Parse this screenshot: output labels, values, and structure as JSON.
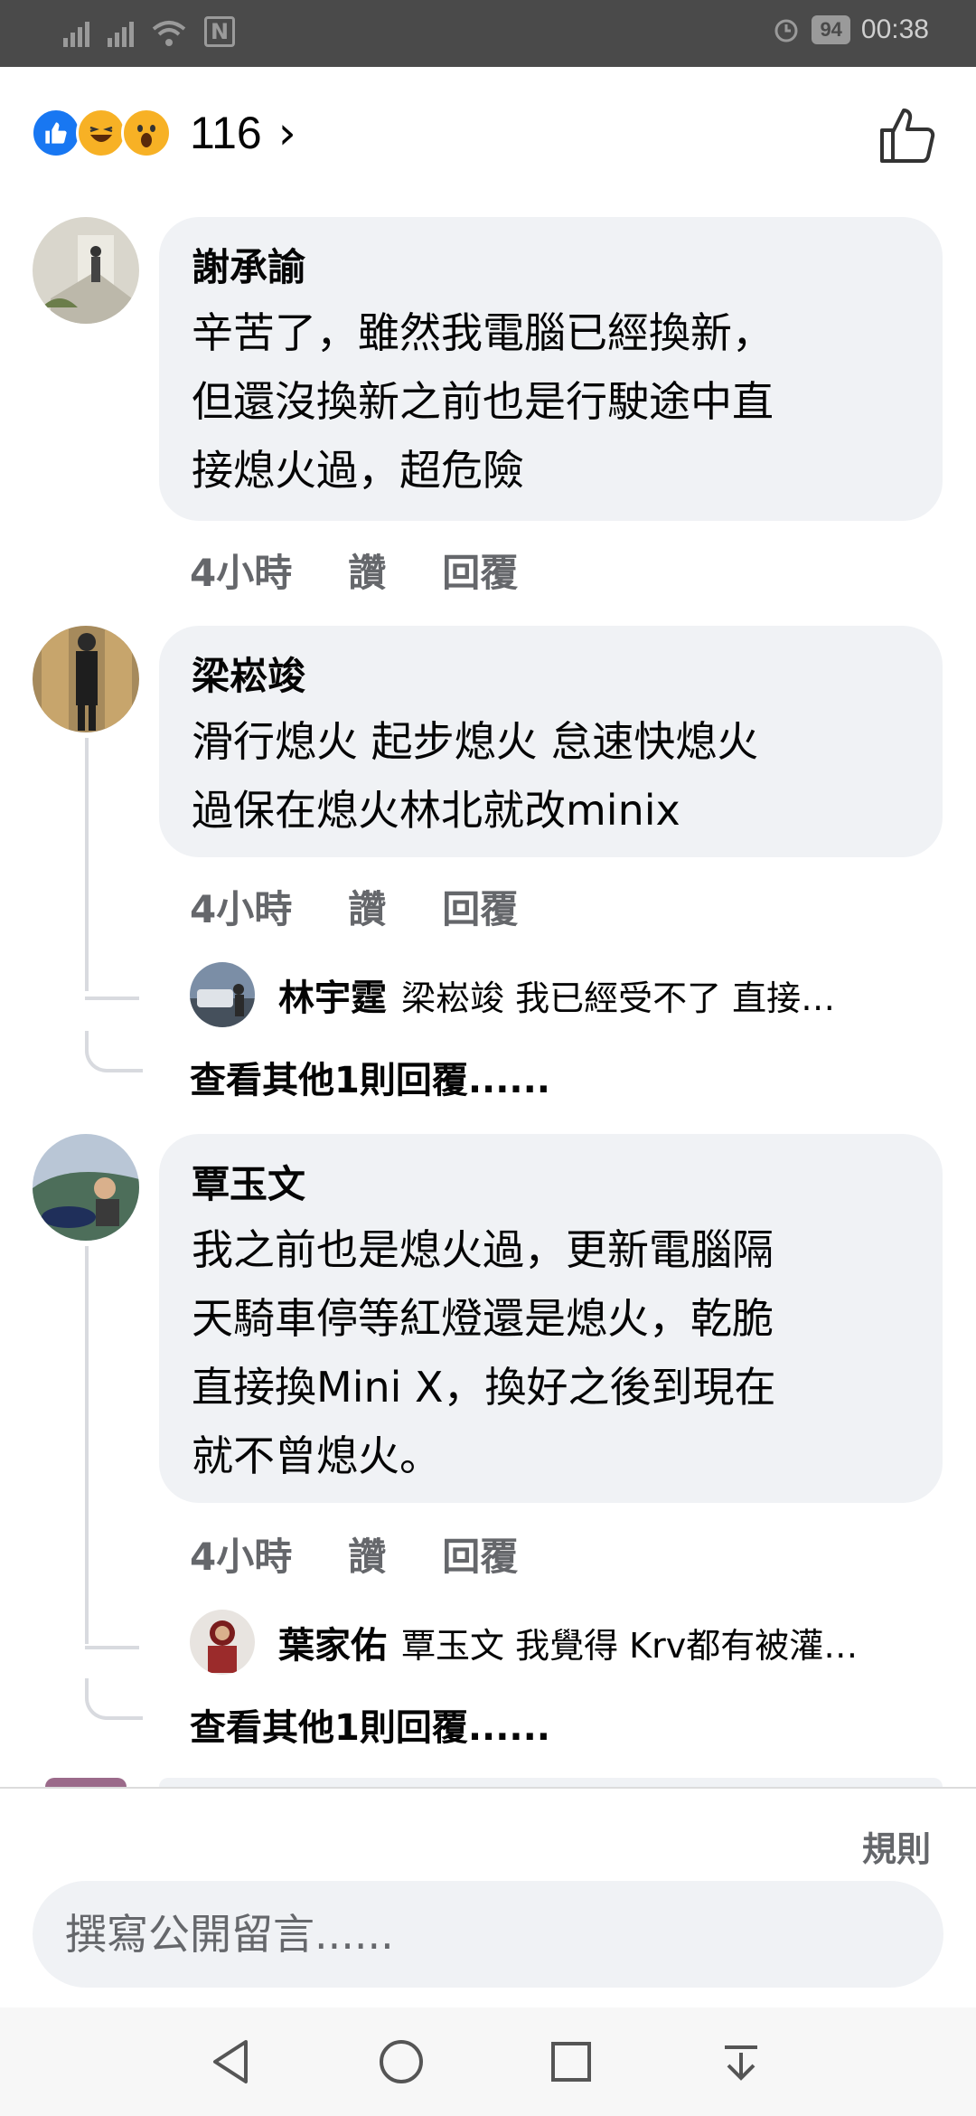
{
  "status_bar": {
    "time": "00:38",
    "battery": "94",
    "nfc_label": "N"
  },
  "reactions": {
    "count": "116",
    "chevron": "›"
  },
  "comments": [
    {
      "author": "謝承諭",
      "text_lines": [
        "辛苦了，雖然我電腦已經換新，",
        "但還沒換新之前也是行駛途中直",
        "接熄火過，超危險"
      ],
      "time": "4小時",
      "like": "讚",
      "reply": "回覆"
    },
    {
      "author": "梁崧竣",
      "text_lines": [
        "滑行熄火 起步熄火 怠速快熄火",
        "過保在熄火林北就改minix"
      ],
      "time": "4小時",
      "like": "讚",
      "reply": "回覆",
      "reply_preview": {
        "name": "林宇霆",
        "text": "梁崧竣 我已經受不了 直接…"
      },
      "more_replies": "查看其他1則回覆......"
    },
    {
      "author": "覃玉文",
      "text_lines": [
        "我之前也是熄火過，更新電腦隔",
        "天騎車停等紅燈還是熄火，乾脆",
        "直接換Mini X，換好之後到現在",
        "就不曾熄火。"
      ],
      "time": "4小時",
      "like": "讚",
      "reply": "回覆",
      "reply_preview": {
        "name": "葉家佑",
        "text": "覃玉文 我覺得 Krv都有被灌…"
      },
      "more_replies": "查看其他1則回覆......"
    }
  ],
  "footer": {
    "rules_label": "規則",
    "composer_placeholder": "撰寫公開留言......"
  },
  "colors": {
    "bubble": "#f0f2f5",
    "like_blue": "#1877f2",
    "meta_gray": "#65676b"
  }
}
